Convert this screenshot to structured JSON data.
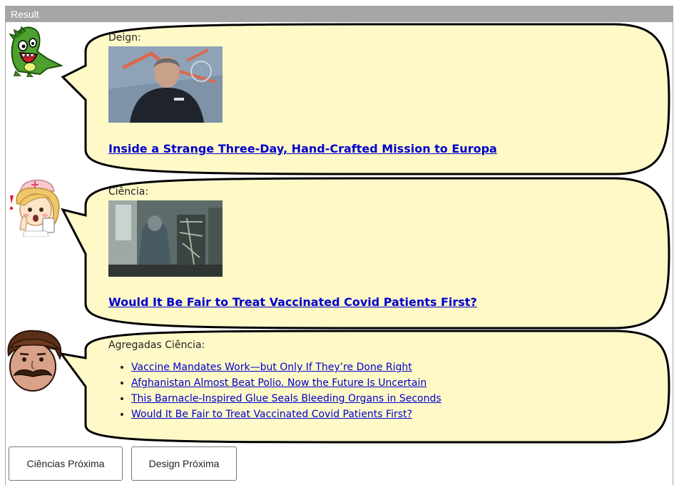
{
  "window": {
    "title": "Result"
  },
  "posts": [
    {
      "label": "Deign:",
      "headline": "Inside a Strange Three-Day, Hand-Crafted Mission to Europa",
      "image_icon": "photo-man-on-floor"
    },
    {
      "label": "Ciência:",
      "headline": "Would It Be Fair to Treat Vaccinated Covid Patients First?",
      "image_icon": "photo-hospital-room"
    }
  ],
  "aggregate": {
    "label": "Agregadas Ciência:",
    "links": [
      "Vaccine Mandates Work—but Only If They’re Done Right",
      "Afghanistan Almost Beat Polio. Now the Future Is Uncertain",
      "This Barnacle-Inspired Glue Seals Bleeding Organs in Seconds",
      "Would It Be Fair to Treat Vaccinated Covid Patients First?"
    ]
  },
  "buttons": {
    "science_next": "Ciências Próxima",
    "design_next": "Design Próxima"
  },
  "avatars": [
    "green-dinosaur-avatar",
    "nurse-avatar",
    "mustache-man-avatar"
  ],
  "colors": {
    "bubble_fill": "#fff9c8",
    "bubble_stroke": "#000000",
    "link": "#0000cc",
    "titlebar": "#a6a6a6"
  }
}
